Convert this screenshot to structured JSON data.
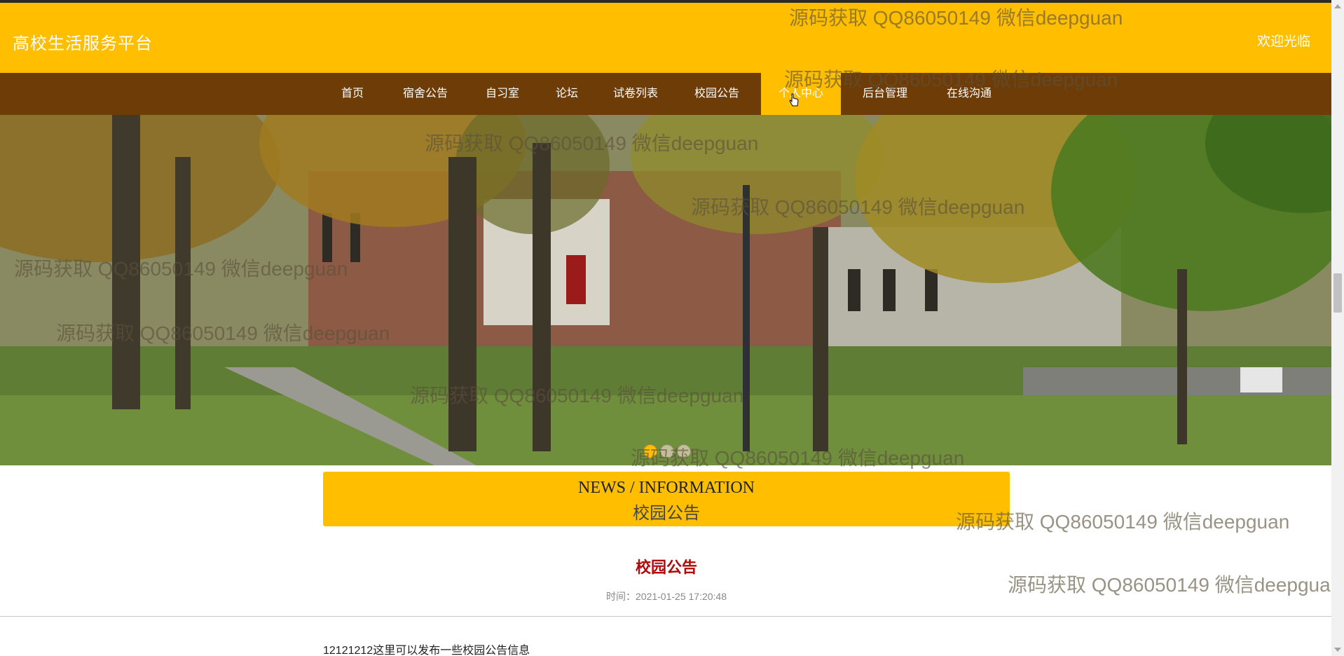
{
  "header": {
    "site_title": "高校生活服务平台",
    "welcome_text": "欢迎光临",
    "background_color": "#ffbe00"
  },
  "nav": {
    "background_color": "#6e3d07",
    "active_color": "#ffbe00",
    "items": [
      {
        "label": "首页"
      },
      {
        "label": "宿舍公告"
      },
      {
        "label": "自习室"
      },
      {
        "label": "论坛"
      },
      {
        "label": "试卷列表"
      },
      {
        "label": "校园公告"
      },
      {
        "label": "个人中心",
        "active": true
      },
      {
        "label": "后台管理"
      },
      {
        "label": "在线沟通"
      }
    ]
  },
  "banner": {
    "image_description_icon": "campus-photo",
    "slides_count": 3,
    "active_slide": 1
  },
  "news_header": {
    "en_title": "NEWS / INFORMATION",
    "cn_title": "校园公告"
  },
  "article": {
    "title": "校园公告",
    "time": "时间：2021-01-25 17:20:48",
    "body": "12121212这里可以发布一些校园公告信息",
    "title_color": "#b00a0a"
  },
  "watermark": {
    "text": "源码获取 QQ86050149 微信deepguan"
  }
}
